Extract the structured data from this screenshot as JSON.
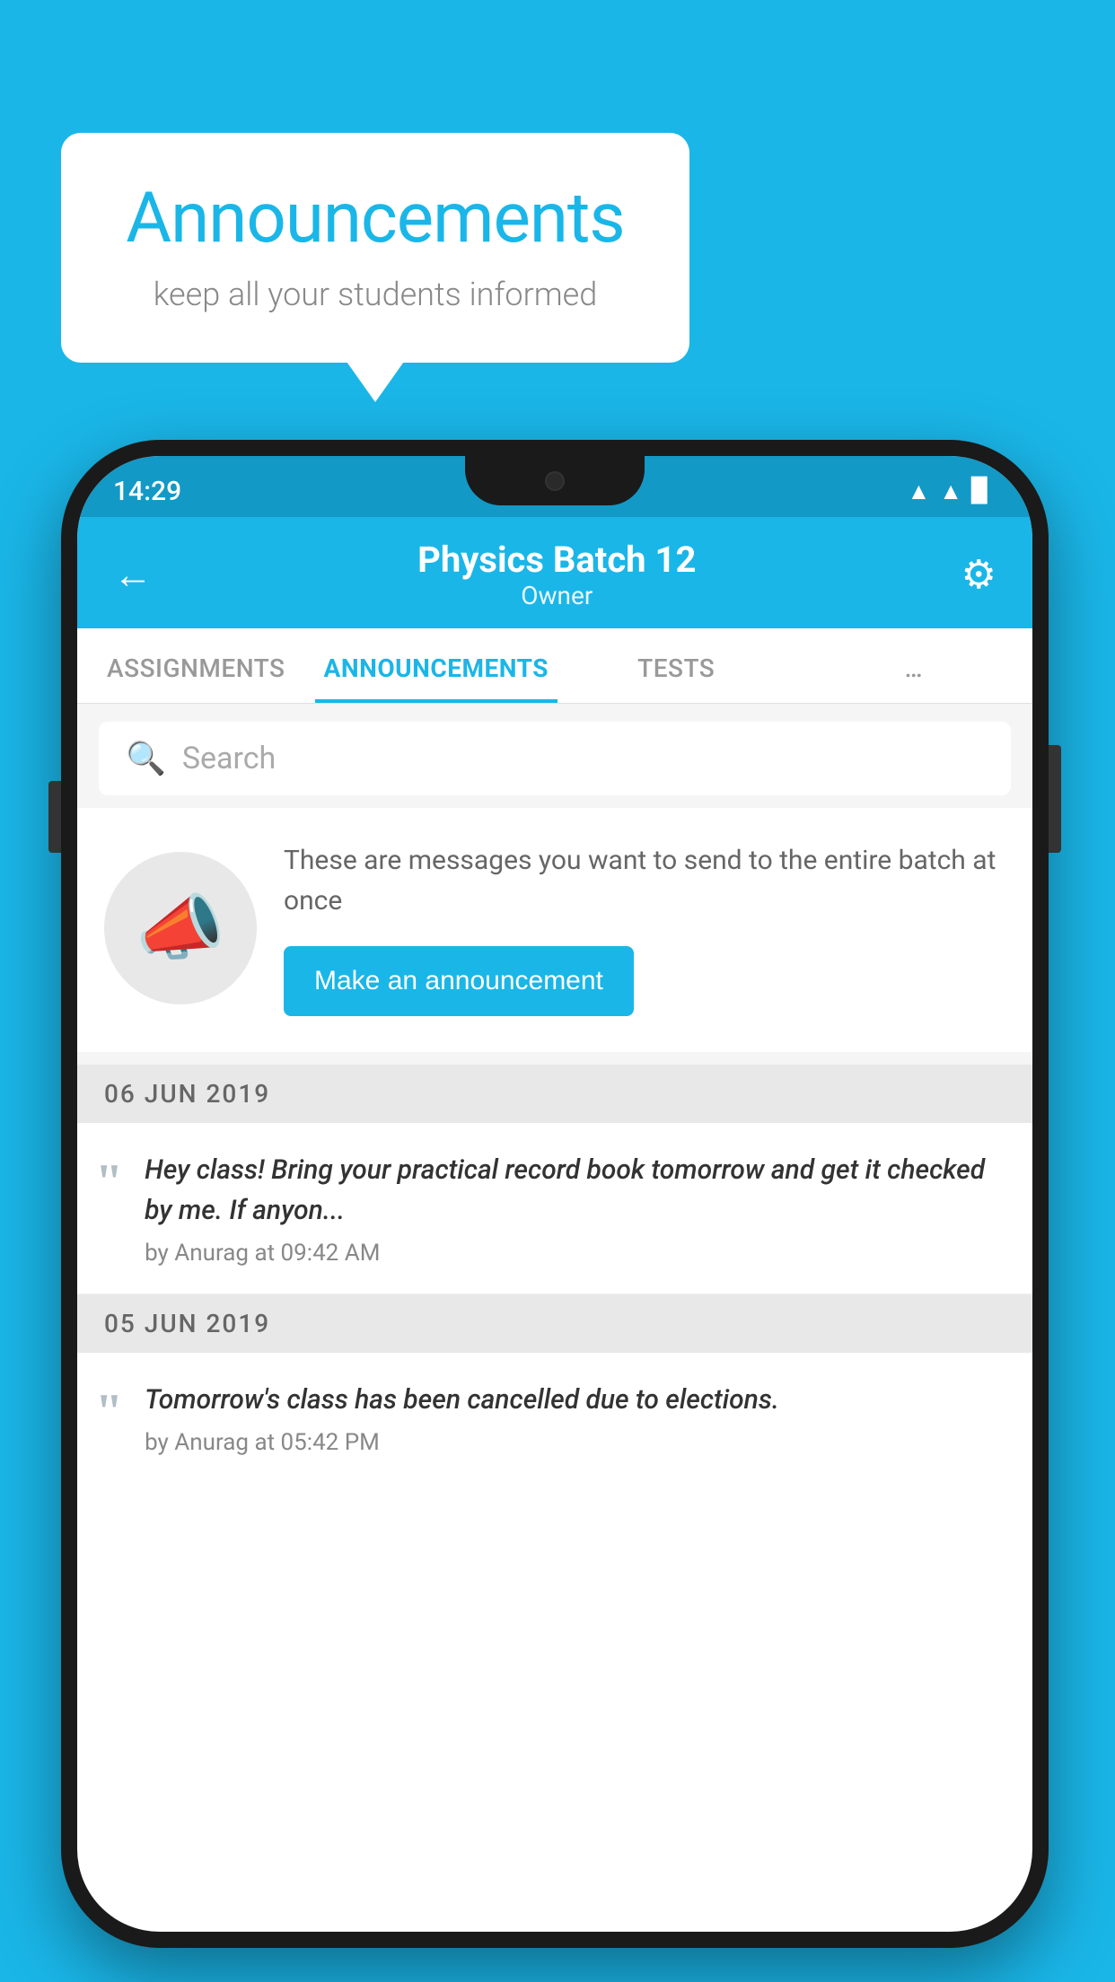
{
  "background_color": "#1ab6e8",
  "speech_bubble": {
    "title": "Announcements",
    "subtitle": "keep all your students informed"
  },
  "status_bar": {
    "time": "14:29",
    "wifi": "▲",
    "signal": "▲",
    "battery": "▉"
  },
  "header": {
    "title": "Physics Batch 12",
    "subtitle": "Owner",
    "back_label": "←",
    "gear_label": "⚙"
  },
  "tabs": [
    {
      "label": "ASSIGNMENTS",
      "active": false
    },
    {
      "label": "ANNOUNCEMENTS",
      "active": true
    },
    {
      "label": "TESTS",
      "active": false
    },
    {
      "label": "…",
      "active": false
    }
  ],
  "search": {
    "placeholder": "Search"
  },
  "announcement_prompt": {
    "description_text": "These are messages you want to send to the entire batch at once",
    "button_label": "Make an announcement"
  },
  "announcements": [
    {
      "date": "06  JUN  2019",
      "text": "Hey class! Bring your practical record book tomorrow and get it checked by me. If anyon...",
      "meta": "by Anurag at 09:42 AM"
    },
    {
      "date": "05  JUN  2019",
      "text": "Tomorrow's class has been cancelled due to elections.",
      "meta": "by Anurag at 05:42 PM"
    }
  ]
}
